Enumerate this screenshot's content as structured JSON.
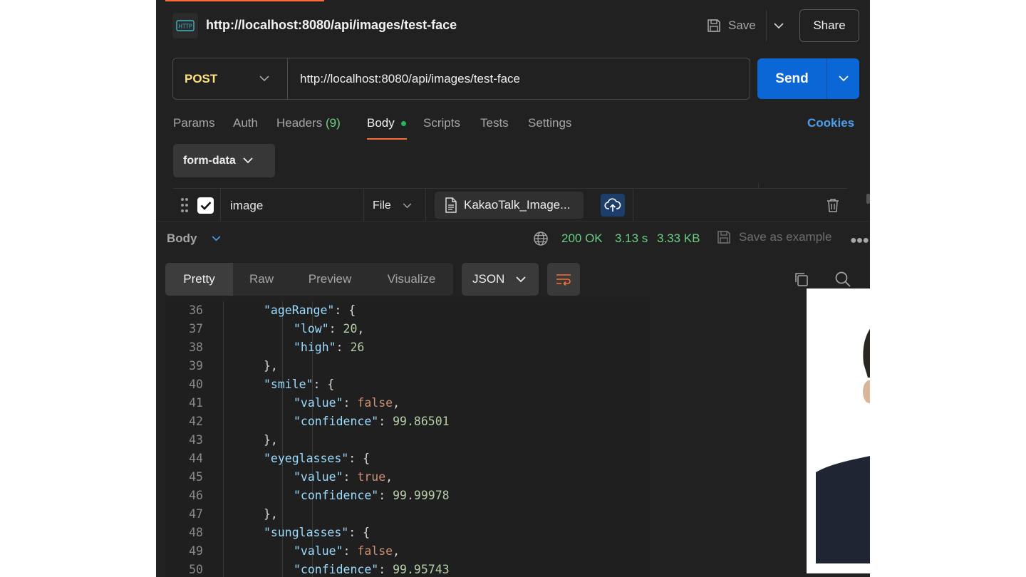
{
  "header": {
    "title": "http://localhost:8080/api/images/test-face",
    "save_label": "Save",
    "share_label": "Share"
  },
  "request": {
    "method": "POST",
    "url": "http://localhost:8080/api/images/test-face",
    "send_label": "Send"
  },
  "tabs": {
    "params": "Params",
    "auth": "Auth",
    "headers": "Headers",
    "headers_count": "(9)",
    "body": "Body",
    "scripts": "Scripts",
    "tests": "Tests",
    "settings": "Settings",
    "cookies": "Cookies"
  },
  "body": {
    "mode": "form-data",
    "row": {
      "key": "image",
      "type": "File",
      "file_name": "KakaoTalk_Image..."
    }
  },
  "response": {
    "label": "Body",
    "status": "200 OK",
    "time": "3.13 s",
    "size": "3.33 KB",
    "save_example": "Save as example",
    "views": [
      "Pretty",
      "Raw",
      "Preview",
      "Visualize"
    ],
    "format": "JSON"
  },
  "code_lines": [
    {
      "n": "36",
      "depth": 2,
      "parts": [
        [
          "k",
          "\"ageRange\""
        ],
        [
          "p",
          ": {"
        ]
      ]
    },
    {
      "n": "37",
      "depth": 3,
      "parts": [
        [
          "k",
          "\"low\""
        ],
        [
          "p",
          ": "
        ],
        [
          "n",
          "20"
        ],
        [
          "p",
          ","
        ]
      ]
    },
    {
      "n": "38",
      "depth": 3,
      "parts": [
        [
          "k",
          "\"high\""
        ],
        [
          "p",
          ": "
        ],
        [
          "n",
          "26"
        ]
      ]
    },
    {
      "n": "39",
      "depth": 2,
      "parts": [
        [
          "p",
          "},"
        ]
      ]
    },
    {
      "n": "40",
      "depth": 2,
      "parts": [
        [
          "k",
          "\"smile\""
        ],
        [
          "p",
          ": {"
        ]
      ]
    },
    {
      "n": "41",
      "depth": 3,
      "parts": [
        [
          "k",
          "\"value\""
        ],
        [
          "p",
          ": "
        ],
        [
          "b",
          "false"
        ],
        [
          "p",
          ","
        ]
      ]
    },
    {
      "n": "42",
      "depth": 3,
      "parts": [
        [
          "k",
          "\"confidence\""
        ],
        [
          "p",
          ": "
        ],
        [
          "n",
          "99.86501"
        ]
      ]
    },
    {
      "n": "43",
      "depth": 2,
      "parts": [
        [
          "p",
          "},"
        ]
      ]
    },
    {
      "n": "44",
      "depth": 2,
      "parts": [
        [
          "k",
          "\"eyeglasses\""
        ],
        [
          "p",
          ": {"
        ]
      ]
    },
    {
      "n": "45",
      "depth": 3,
      "parts": [
        [
          "k",
          "\"value\""
        ],
        [
          "p",
          ": "
        ],
        [
          "b",
          "true"
        ],
        [
          "p",
          ","
        ]
      ]
    },
    {
      "n": "46",
      "depth": 3,
      "parts": [
        [
          "k",
          "\"confidence\""
        ],
        [
          "p",
          ": "
        ],
        [
          "n",
          "99.99978"
        ]
      ]
    },
    {
      "n": "47",
      "depth": 2,
      "parts": [
        [
          "p",
          "},"
        ]
      ]
    },
    {
      "n": "48",
      "depth": 2,
      "parts": [
        [
          "k",
          "\"sunglasses\""
        ],
        [
          "p",
          ": {"
        ]
      ]
    },
    {
      "n": "49",
      "depth": 3,
      "parts": [
        [
          "k",
          "\"value\""
        ],
        [
          "p",
          ": "
        ],
        [
          "b",
          "false"
        ],
        [
          "p",
          ","
        ]
      ]
    },
    {
      "n": "50",
      "depth": 3,
      "parts": [
        [
          "k",
          "\"confidence\""
        ],
        [
          "p",
          ": "
        ],
        [
          "n",
          "99.95743"
        ]
      ]
    }
  ],
  "icons": {
    "http": "http-icon",
    "save": "save-icon",
    "chevron": "chevron-down-icon",
    "upload": "cloud-upload-icon",
    "trash": "trash-icon",
    "globe": "globe-icon",
    "copy": "copy-icon",
    "search": "search-icon",
    "wrap": "wrap-lines-icon"
  },
  "colors": {
    "method": "#ffe47e",
    "accent": "#ff6c37",
    "send": "#0b66d6",
    "status_ok": "#6ccf83",
    "cookies": "#4c9ff0"
  }
}
